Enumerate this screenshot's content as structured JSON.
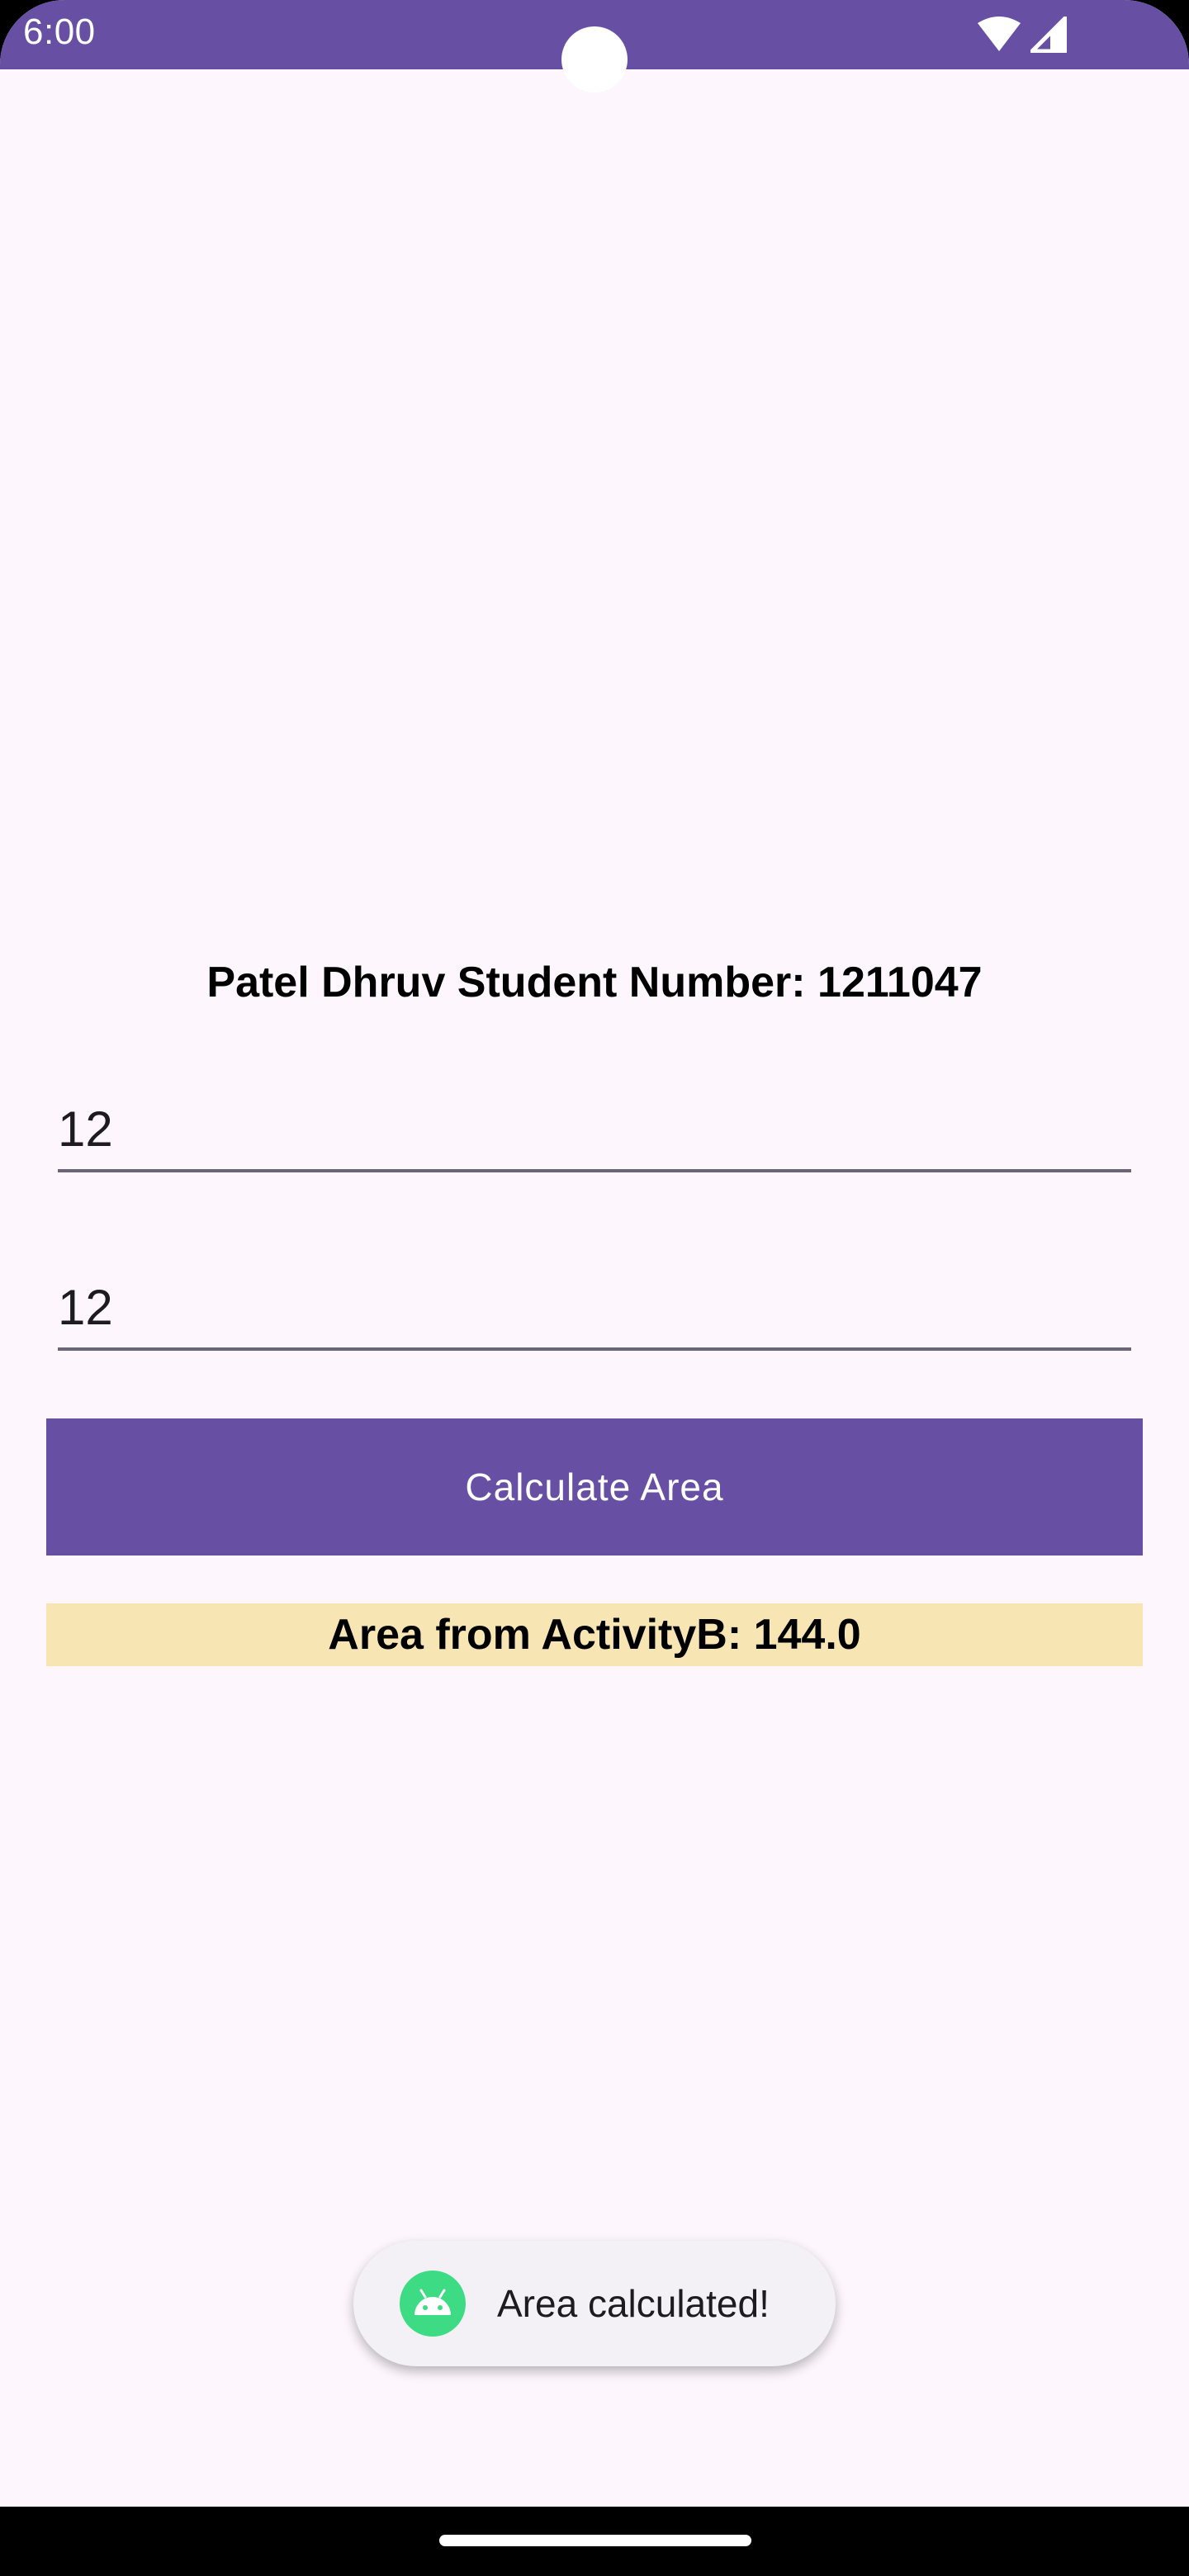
{
  "status_bar": {
    "time": "6:00",
    "icons": [
      "wifi-icon",
      "cell-signal-icon"
    ],
    "color": "#6750a4"
  },
  "main": {
    "title": "Patel Dhruv Student Number: 1211047",
    "input_1_value": "12",
    "input_2_value": "12",
    "button_label": "Calculate Area",
    "result_text": "Area from ActivityB: 144.0"
  },
  "toast": {
    "text": "Area calculated!",
    "icon": "android-icon"
  },
  "colors": {
    "primary": "#6750a4",
    "background": "#fdf7fd",
    "result_background": "#f8e5b4",
    "android_green": "#3ddc84"
  }
}
